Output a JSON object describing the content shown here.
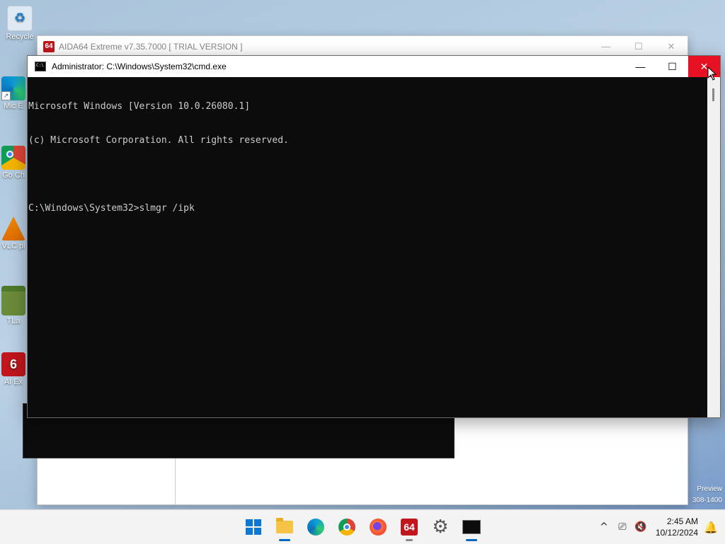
{
  "desktop": {
    "icons": [
      {
        "label": "Recycle",
        "icon": "recycle-bin-icon",
        "color": "#dfe9f3"
      },
      {
        "label": "Mic E",
        "icon": "edge-icon",
        "color": "#1a8fe0"
      },
      {
        "label": "Go Ch",
        "icon": "chrome-icon",
        "color": "#db4437"
      },
      {
        "label": "VLC pl",
        "icon": "vlc-icon",
        "color": "#f08a00"
      },
      {
        "label": "TLa",
        "icon": "minecraft-icon",
        "color": "#6b8c3a"
      },
      {
        "label": "AI Ex",
        "icon": "aida64-icon",
        "color": "#c0161c"
      }
    ],
    "watermark": [
      "Preview",
      "308-1400"
    ]
  },
  "aida_window": {
    "logo": "64",
    "title": "AIDA64 Extreme v7.35.7000  [ TRIAL VERSION ]",
    "controls": {
      "minimize": "—",
      "maximize": "☐",
      "close": "✕"
    }
  },
  "cmd_window": {
    "title": "Administrator: C:\\Windows\\System32\\cmd.exe",
    "controls": {
      "minimize": "—",
      "maximize": "☐",
      "close": "✕"
    },
    "lines": [
      "Microsoft Windows [Version 10.0.26080.1]",
      "(c) Microsoft Corporation. All rights reserved.",
      "",
      "C:\\Windows\\System32>slmgr /ipk"
    ]
  },
  "taskbar": {
    "apps": [
      {
        "name": "start",
        "icon": "windows-start-icon"
      },
      {
        "name": "file-explorer",
        "icon": "folder-icon"
      },
      {
        "name": "edge",
        "icon": "edge-icon"
      },
      {
        "name": "chrome",
        "icon": "chrome-icon"
      },
      {
        "name": "firefox",
        "icon": "firefox-icon"
      },
      {
        "name": "aida64",
        "icon": "aida64-icon",
        "label": "64"
      },
      {
        "name": "settings",
        "icon": "gear-icon"
      },
      {
        "name": "cmd",
        "icon": "terminal-icon"
      }
    ],
    "tray": {
      "chevron": "^",
      "time": "2:45 AM",
      "date": "10/12/2024"
    }
  }
}
